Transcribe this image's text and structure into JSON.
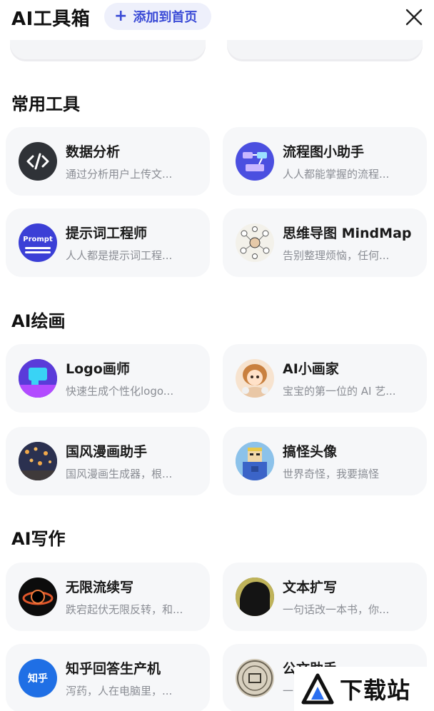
{
  "header": {
    "title": "AI工具箱",
    "add_button_label": "添加到首页",
    "plus_glyph": "+"
  },
  "sections": [
    {
      "title": "常用工具",
      "cards": [
        {
          "name": "数据分析",
          "desc": "通过分析用户上传文..."
        },
        {
          "name": "流程图小助手",
          "desc": "人人都能掌握的流程..."
        },
        {
          "name": "提示词工程师",
          "desc": "人人都是提示词工程...",
          "icon_text": "Prompt"
        },
        {
          "name": "思维导图 MindMap",
          "desc": "告别整理烦恼，任何..."
        }
      ]
    },
    {
      "title": "AI绘画",
      "cards": [
        {
          "name": "Logo画师",
          "desc": "快速生成个性化logo..."
        },
        {
          "name": "AI小画家",
          "desc": "宝宝的第一位的 AI 艺..."
        },
        {
          "name": "国风漫画助手",
          "desc": "国风漫画生成器，根..."
        },
        {
          "name": "搞怪头像",
          "desc": "世界奇怪，我要搞怪"
        }
      ]
    },
    {
      "title": "AI写作",
      "cards": [
        {
          "name": "无限流续写",
          "desc": "跌宕起伏无限反转，和..."
        },
        {
          "name": "文本扩写",
          "desc": "一句话改一本书，你..."
        },
        {
          "name": "知乎回答生产机",
          "desc": "泻药，人在电脑里，...",
          "icon_text": "知乎"
        },
        {
          "name": "公文助手",
          "desc": "一..."
        }
      ]
    }
  ],
  "watermark": {
    "text": "下载站"
  },
  "colors": {
    "accent": "#3a4bd6",
    "card_bg": "#f6f7f9",
    "desc_gray": "#8a8d94"
  }
}
